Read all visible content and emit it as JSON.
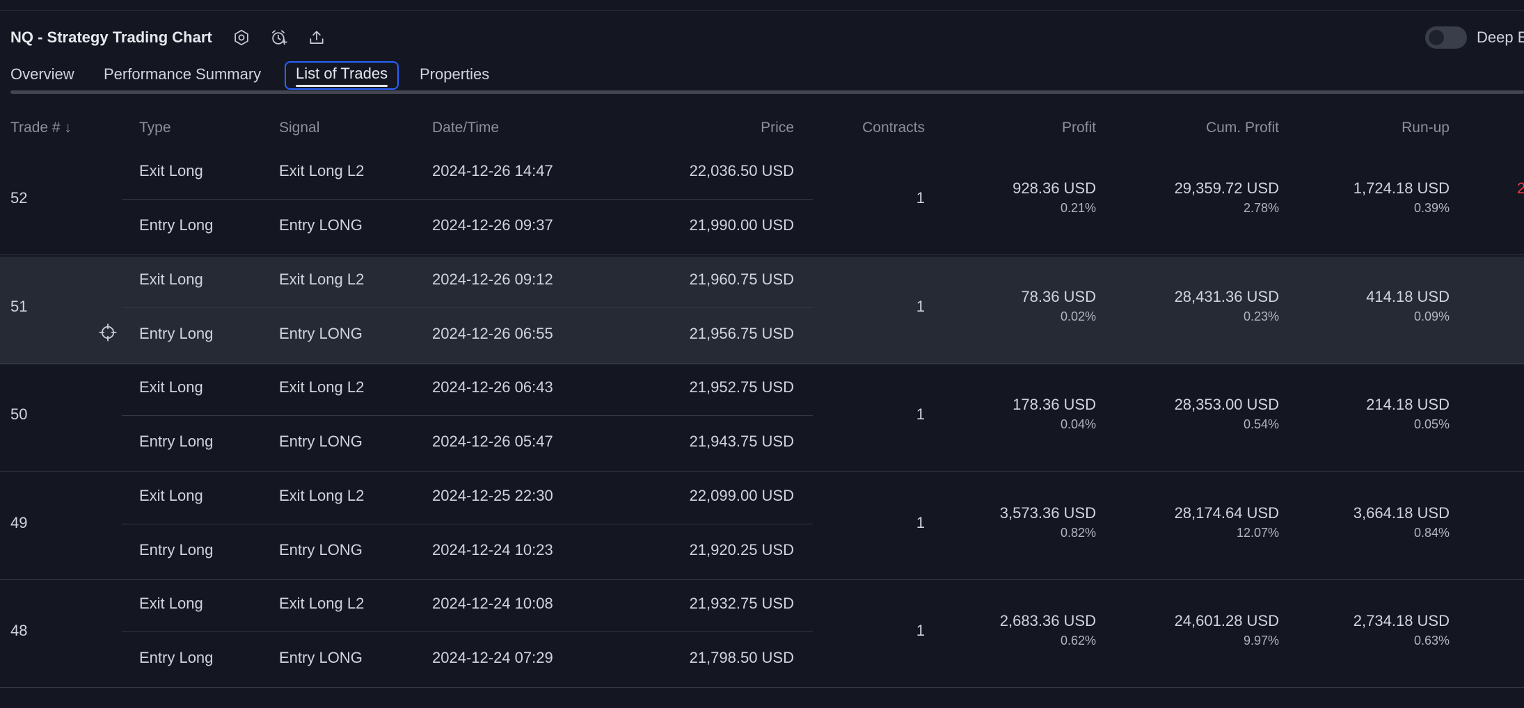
{
  "header": {
    "title": "NQ - Strategy Trading Chart",
    "toggle_label": "Deep E"
  },
  "tabs": [
    {
      "label": "Overview",
      "active": false
    },
    {
      "label": "Performance Summary",
      "active": false
    },
    {
      "label": "List of Trades",
      "active": true
    },
    {
      "label": "Properties",
      "active": false
    }
  ],
  "columns": {
    "trade": "Trade # ↓",
    "type": "Type",
    "signal": "Signal",
    "datetime": "Date/Time",
    "price": "Price",
    "contracts": "Contracts",
    "profit": "Profit",
    "cum_profit": "Cum. Profit",
    "runup": "Run-up"
  },
  "trades": [
    {
      "num": "52",
      "exit": {
        "type": "Exit Long",
        "signal": "Exit Long L2",
        "datetime": "2024-12-26 14:47",
        "price": "22,036.50 USD"
      },
      "entry": {
        "type": "Entry Long",
        "signal": "Entry LONG",
        "datetime": "2024-12-26 09:37",
        "price": "21,990.00 USD"
      },
      "contracts": "1",
      "profit": "928.36 USD",
      "profit_pct": "0.21%",
      "cum_profit": "29,359.72 USD",
      "cum_profit_pct": "2.78%",
      "runup": "1,724.18 USD",
      "runup_pct": "0.39%",
      "edge": "2"
    },
    {
      "num": "51",
      "exit": {
        "type": "Exit Long",
        "signal": "Exit Long L2",
        "datetime": "2024-12-26 09:12",
        "price": "21,960.75 USD"
      },
      "entry": {
        "type": "Entry Long",
        "signal": "Entry LONG",
        "datetime": "2024-12-26 06:55",
        "price": "21,956.75 USD"
      },
      "contracts": "1",
      "profit": "78.36 USD",
      "profit_pct": "0.02%",
      "cum_profit": "28,431.36 USD",
      "cum_profit_pct": "0.23%",
      "runup": "414.18 USD",
      "runup_pct": "0.09%",
      "edge": ""
    },
    {
      "num": "50",
      "exit": {
        "type": "Exit Long",
        "signal": "Exit Long L2",
        "datetime": "2024-12-26 06:43",
        "price": "21,952.75 USD"
      },
      "entry": {
        "type": "Entry Long",
        "signal": "Entry LONG",
        "datetime": "2024-12-26 05:47",
        "price": "21,943.75 USD"
      },
      "contracts": "1",
      "profit": "178.36 USD",
      "profit_pct": "0.04%",
      "cum_profit": "28,353.00 USD",
      "cum_profit_pct": "0.54%",
      "runup": "214.18 USD",
      "runup_pct": "0.05%",
      "edge": ""
    },
    {
      "num": "49",
      "exit": {
        "type": "Exit Long",
        "signal": "Exit Long L2",
        "datetime": "2024-12-25 22:30",
        "price": "22,099.00 USD"
      },
      "entry": {
        "type": "Entry Long",
        "signal": "Entry LONG",
        "datetime": "2024-12-24 10:23",
        "price": "21,920.25 USD"
      },
      "contracts": "1",
      "profit": "3,573.36 USD",
      "profit_pct": "0.82%",
      "cum_profit": "28,174.64 USD",
      "cum_profit_pct": "12.07%",
      "runup": "3,664.18 USD",
      "runup_pct": "0.84%",
      "edge": ""
    },
    {
      "num": "48",
      "exit": {
        "type": "Exit Long",
        "signal": "Exit Long L2",
        "datetime": "2024-12-24 10:08",
        "price": "21,932.75 USD"
      },
      "entry": {
        "type": "Entry Long",
        "signal": "Entry LONG",
        "datetime": "2024-12-24 07:29",
        "price": "21,798.50 USD"
      },
      "contracts": "1",
      "profit": "2,683.36 USD",
      "profit_pct": "0.62%",
      "cum_profit": "24,601.28 USD",
      "cum_profit_pct": "9.97%",
      "runup": "2,734.18 USD",
      "runup_pct": "0.63%",
      "edge": ""
    }
  ],
  "highlighted_trade_index": 1,
  "icons": {
    "settings": "settings-icon",
    "alert": "add-alert-icon",
    "export": "export-icon",
    "target": "crosshair-icon"
  },
  "colors": {
    "background": "#141722",
    "highlight_row": "#262a35",
    "accent": "#2962ff",
    "negative": "#f23645"
  }
}
